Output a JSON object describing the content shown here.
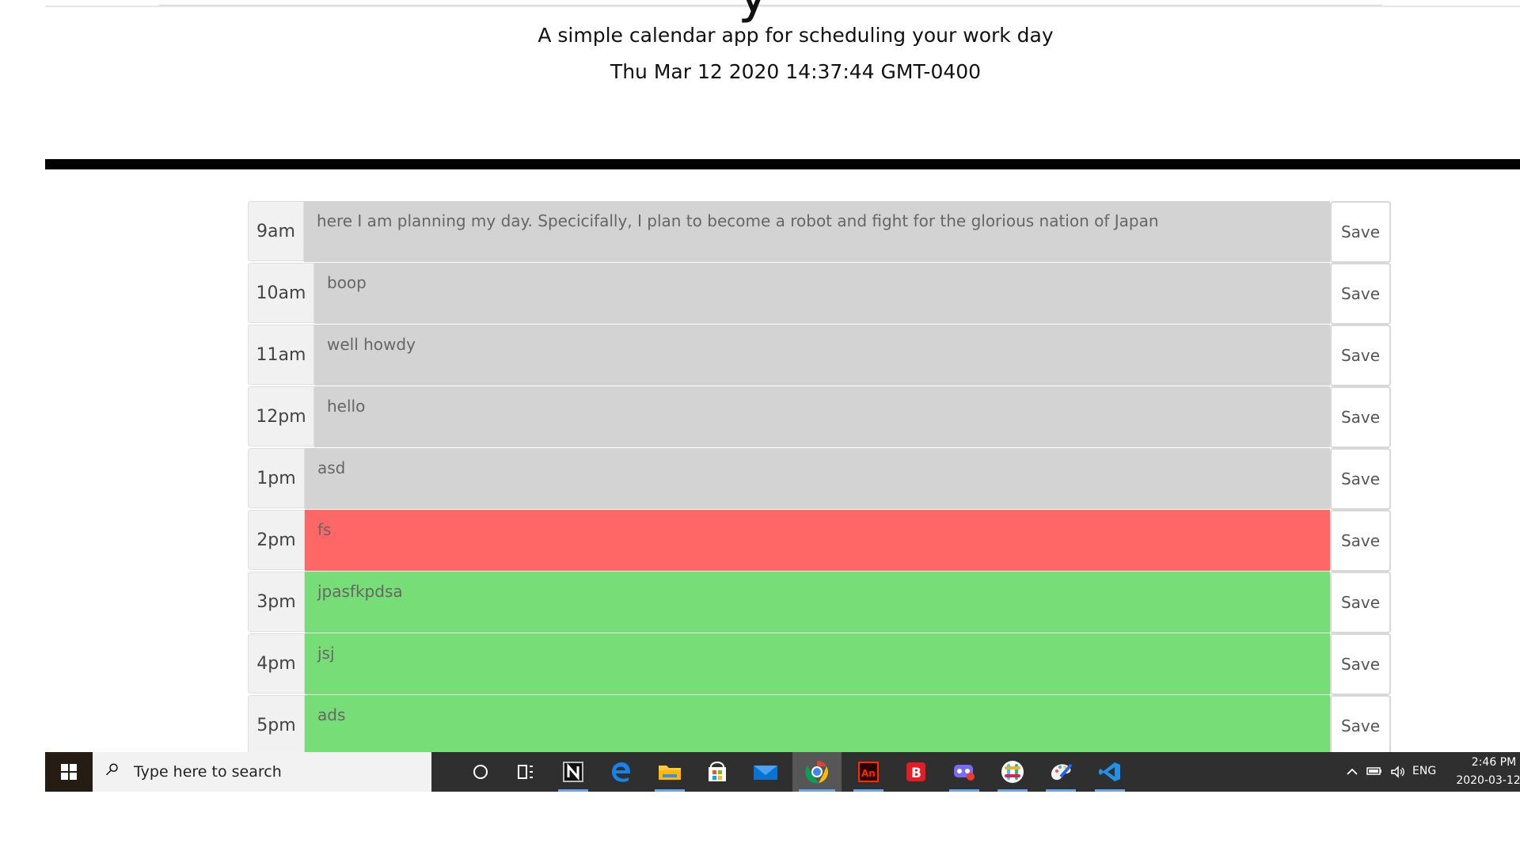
{
  "header": {
    "title_fragment": "y",
    "lead": "A simple calendar app for scheduling your work day",
    "current_day": "Thu Mar 12 2020 14:37:44 GMT-0400"
  },
  "planner": {
    "blocks": [
      {
        "hour": "9am",
        "text": "here I am planning my day. Specicifally, I plan to become a robot and fight for the glorious nation of Japan",
        "status": "past",
        "save_label": "Save"
      },
      {
        "hour": "10am",
        "text": "boop",
        "status": "past",
        "save_label": "Save"
      },
      {
        "hour": "11am",
        "text": "well howdy",
        "status": "past",
        "save_label": "Save"
      },
      {
        "hour": "12pm",
        "text": "hello",
        "status": "past",
        "save_label": "Save"
      },
      {
        "hour": "1pm",
        "text": "asd",
        "status": "past",
        "save_label": "Save"
      },
      {
        "hour": "2pm",
        "text": "fs",
        "status": "present",
        "save_label": "Save"
      },
      {
        "hour": "3pm",
        "text": "jpasfkpdsa",
        "status": "future",
        "save_label": "Save"
      },
      {
        "hour": "4pm",
        "text": "jsj",
        "status": "future",
        "save_label": "Save"
      },
      {
        "hour": "5pm",
        "text": "ads",
        "status": "future",
        "save_label": "Save"
      }
    ]
  },
  "colors": {
    "past": "#d3d3d3",
    "present": "#ff6666",
    "future": "#77dd77",
    "taskbar": "#2f2f2f"
  },
  "taskbar": {
    "search_placeholder": "Type here to search",
    "icons": [
      "cortana-icon",
      "task-view-icon",
      "notion-icon",
      "edge-icon",
      "file-explorer-icon",
      "store-icon",
      "mail-icon",
      "chrome-icon",
      "animate-icon",
      "b-app-icon",
      "game-bar-icon",
      "slack-icon",
      "paint-icon",
      "vscode-icon"
    ],
    "tray": {
      "language": "ENG",
      "time": "2:46 PM",
      "date": "2020-03-12"
    }
  }
}
